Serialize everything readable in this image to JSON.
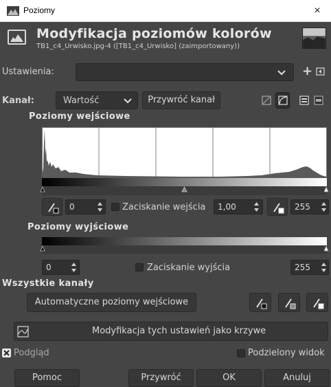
{
  "window": {
    "title": "Poziomy",
    "close_glyph": "×"
  },
  "header": {
    "title": "Modyfikacja poziomów kolorów",
    "subtitle": "TB1_c4_Urwisko.jpg-4 ([TB1_c4_Urwisko] (zaimportowany))",
    "icon": "levels-icon",
    "thumbnail": "image-thumbnail"
  },
  "presets": {
    "label": "Ustawienia:",
    "value": "",
    "add_glyph": "+",
    "menu_glyph": "◂"
  },
  "channel": {
    "label": "Kanał:",
    "value": "Wartość",
    "reset_label": "Przywróć kanał"
  },
  "input_levels": {
    "heading": "Poziomy wejściowe",
    "low": "0",
    "clamp_label": "Zaciskanie wejścia",
    "gamma": "1,00",
    "high": "255",
    "gamma_position": 0.5
  },
  "output_levels": {
    "heading": "Poziomy wyjściowe",
    "low": "0",
    "clamp_label": "Zaciskanie wyjścia",
    "high": "255"
  },
  "all_channels": {
    "heading": "Wszystkie kanały",
    "auto_label": "Automatyczne poziomy wejściowe"
  },
  "curves": {
    "label": "Modyfikacja tych ustawień jako krzywe"
  },
  "options": {
    "preview_label": "Podgląd",
    "preview_checked": true,
    "split_label": "Podzielony widok",
    "split_checked": false
  },
  "buttons": {
    "help": "Pomoc",
    "reset": "Przywróć",
    "ok": "OK",
    "cancel": "Anuluj"
  },
  "colors": {
    "background": "#454545",
    "field": "#333333",
    "text": "#d2d2d2"
  }
}
